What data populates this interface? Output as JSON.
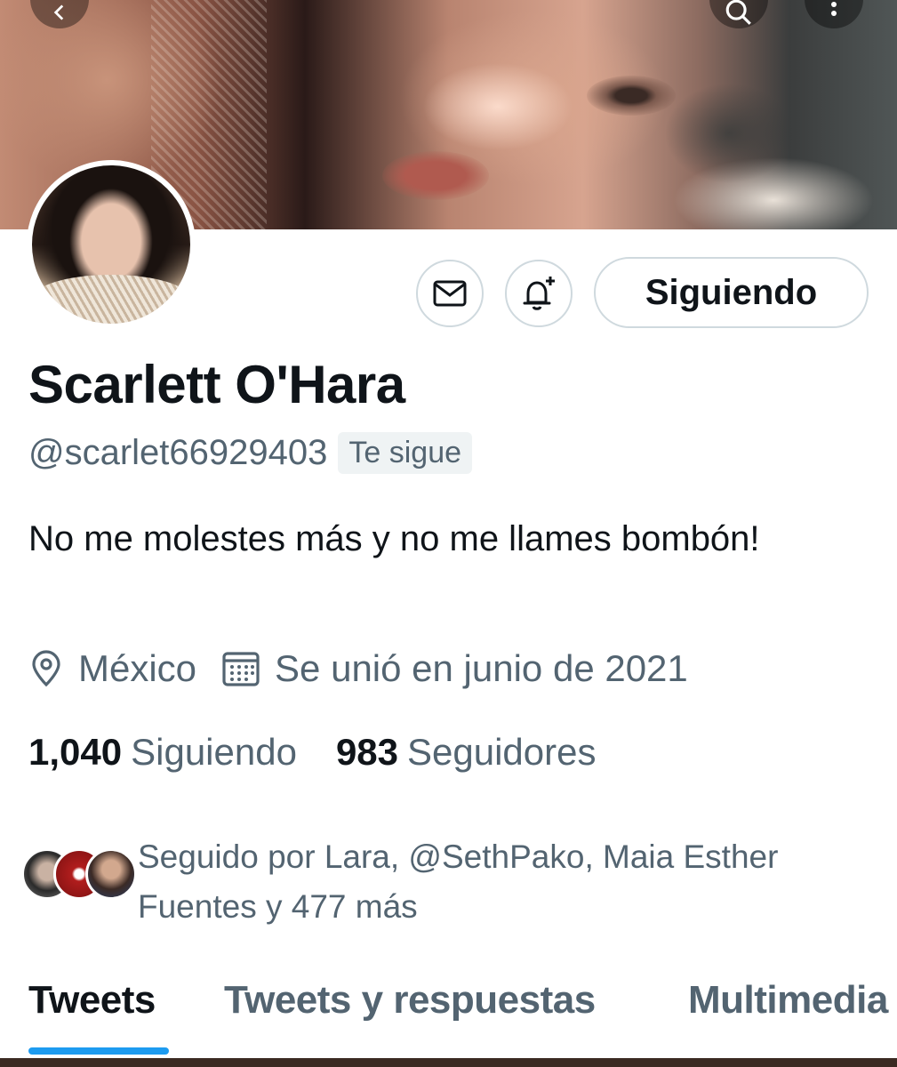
{
  "profile": {
    "name": "Scarlett O'Hara",
    "handle": "@scarlet66929403",
    "follows_you_badge": "Te sigue",
    "bio": "No me molestes más y no me llames bombón!",
    "location": "México",
    "joined": "Se unió en junio de 2021",
    "following_count": "1,040",
    "following_label": "Siguiendo",
    "followers_count": "983",
    "followers_label": "Seguidores",
    "followed_by_text": "Seguido por Lara, @SethPako, Maia Esther Fuentes y 477 más"
  },
  "actions": {
    "follow_state_label": "Siguiendo",
    "message_icon": "envelope-icon",
    "notify_icon": "bell-plus-icon"
  },
  "header": {
    "back_icon": "arrow-left-icon",
    "search_icon": "search-icon",
    "more_icon": "more-vertical-icon"
  },
  "tabs": [
    {
      "label": "Tweets",
      "active": true
    },
    {
      "label": "Tweets y respuestas",
      "active": false
    },
    {
      "label": "Multimedia",
      "active": false
    }
  ],
  "colors": {
    "accent": "#1d9bf0",
    "text_primary": "#0f1419",
    "text_secondary": "#536471",
    "border": "#cfd9de"
  }
}
